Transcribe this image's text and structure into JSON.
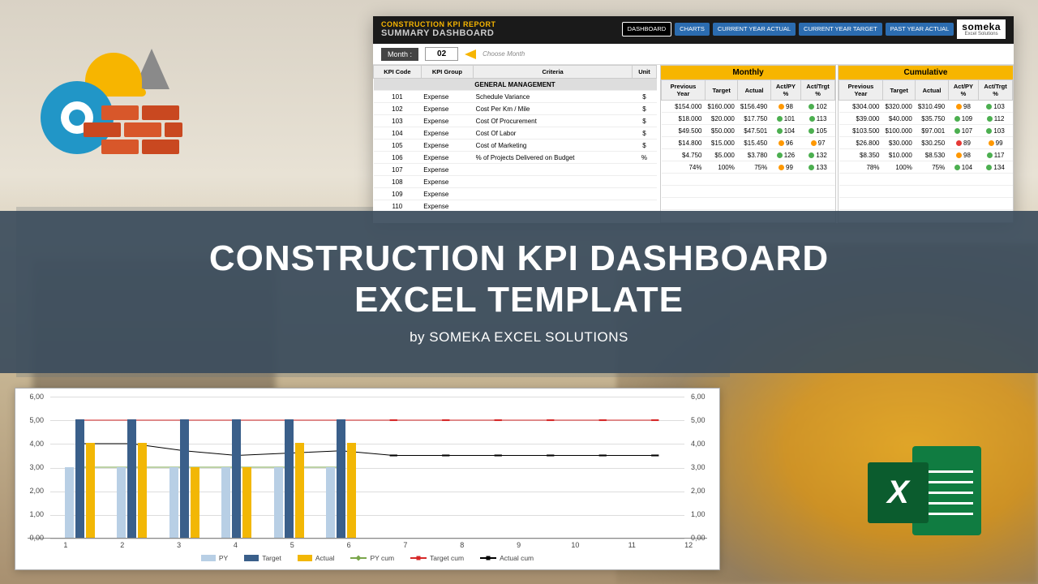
{
  "header": {
    "report": "CONSTRUCTION KPI REPORT",
    "subtitle": "SUMMARY DASHBOARD",
    "tabs": [
      "DASHBOARD",
      "CHARTS",
      "CURRENT YEAR ACTUAL",
      "CURRENT YEAR TARGET",
      "PAST YEAR ACTUAL"
    ],
    "logo_main": "someka",
    "logo_sub": "Excel Solutions"
  },
  "month": {
    "label": "Month :",
    "value": "02",
    "choose": "Choose Month"
  },
  "left_headers": [
    "KPI Code",
    "KPI Group",
    "Criteria",
    "Unit"
  ],
  "section": "GENERAL MANAGEMENT",
  "metric_titles": {
    "monthly": "Monthly",
    "cumulative": "Cumulative"
  },
  "metric_headers": [
    "Previous Year",
    "Target",
    "Actual",
    "Act/PY %",
    "Act/Trgt %"
  ],
  "rows": [
    {
      "code": "101",
      "group": "Expense",
      "crit": "Schedule Variance",
      "unit": "$",
      "m": {
        "py": "$154.000",
        "tg": "$160.000",
        "ac": "$156.490",
        "apy": "98",
        "apyc": "o",
        "atg": "102",
        "atgc": "g"
      },
      "c": {
        "py": "$304.000",
        "tg": "$320.000",
        "ac": "$310.490",
        "apy": "98",
        "apyc": "o",
        "atg": "103",
        "atgc": "g"
      }
    },
    {
      "code": "102",
      "group": "Expense",
      "crit": "Cost Per Km / Mile",
      "unit": "$",
      "m": {
        "py": "$18.000",
        "tg": "$20.000",
        "ac": "$17.750",
        "apy": "101",
        "apyc": "g",
        "atg": "113",
        "atgc": "g"
      },
      "c": {
        "py": "$39.000",
        "tg": "$40.000",
        "ac": "$35.750",
        "apy": "109",
        "apyc": "g",
        "atg": "112",
        "atgc": "g"
      }
    },
    {
      "code": "103",
      "group": "Expense",
      "crit": "Cost Of Procurement",
      "unit": "$",
      "m": {
        "py": "$49.500",
        "tg": "$50.000",
        "ac": "$47.501",
        "apy": "104",
        "apyc": "g",
        "atg": "105",
        "atgc": "g"
      },
      "c": {
        "py": "$103.500",
        "tg": "$100.000",
        "ac": "$97.001",
        "apy": "107",
        "apyc": "g",
        "atg": "103",
        "atgc": "g"
      }
    },
    {
      "code": "104",
      "group": "Expense",
      "crit": "Cost Of Labor",
      "unit": "$",
      "m": {
        "py": "$14.800",
        "tg": "$15.000",
        "ac": "$15.450",
        "apy": "96",
        "apyc": "o",
        "atg": "97",
        "atgc": "o"
      },
      "c": {
        "py": "$26.800",
        "tg": "$30.000",
        "ac": "$30.250",
        "apy": "89",
        "apyc": "r",
        "atg": "99",
        "atgc": "o"
      }
    },
    {
      "code": "105",
      "group": "Expense",
      "crit": "Cost of Marketing",
      "unit": "$",
      "m": {
        "py": "$4.750",
        "tg": "$5.000",
        "ac": "$3.780",
        "apy": "126",
        "apyc": "g",
        "atg": "132",
        "atgc": "g"
      },
      "c": {
        "py": "$8.350",
        "tg": "$10.000",
        "ac": "$8.530",
        "apy": "98",
        "apyc": "o",
        "atg": "117",
        "atgc": "g"
      }
    },
    {
      "code": "106",
      "group": "Expense",
      "crit": "% of Projects Delivered on Budget",
      "unit": "%",
      "m": {
        "py": "74%",
        "tg": "100%",
        "ac": "75%",
        "apy": "99",
        "apyc": "o",
        "atg": "133",
        "atgc": "g"
      },
      "c": {
        "py": "78%",
        "tg": "100%",
        "ac": "75%",
        "apy": "104",
        "apyc": "g",
        "atg": "134",
        "atgc": "g"
      }
    },
    {
      "code": "107",
      "group": "Expense",
      "crit": "",
      "unit": ""
    },
    {
      "code": "108",
      "group": "Expense",
      "crit": "",
      "unit": ""
    },
    {
      "code": "109",
      "group": "Expense",
      "crit": "",
      "unit": ""
    },
    {
      "code": "110",
      "group": "Expense",
      "crit": "",
      "unit": ""
    }
  ],
  "banner": {
    "line1": "CONSTRUCTION KPI DASHBOARD",
    "line2": "EXCEL TEMPLATE",
    "sub": "by SOMEKA EXCEL SOLUTIONS"
  },
  "excel_badge": "X",
  "chart_data": {
    "type": "bar",
    "categories": [
      "1",
      "2",
      "3",
      "4",
      "5",
      "6",
      "7",
      "8",
      "9",
      "10",
      "11",
      "12"
    ],
    "ylim": [
      0,
      6
    ],
    "yticks": [
      "0,00",
      "1,00",
      "2,00",
      "3,00",
      "4,00",
      "5,00",
      "6,00"
    ],
    "series_bars": [
      {
        "name": "PY",
        "color": "#b8cfe5",
        "values": [
          3.0,
          3.0,
          3.0,
          3.0,
          3.0,
          3.0,
          null,
          null,
          null,
          null,
          null,
          null
        ]
      },
      {
        "name": "Target",
        "color": "#3a5f8a",
        "values": [
          5.0,
          5.0,
          5.0,
          5.0,
          5.0,
          5.0,
          null,
          null,
          null,
          null,
          null,
          null
        ]
      },
      {
        "name": "Actual",
        "color": "#f2b705",
        "values": [
          4.0,
          4.0,
          3.0,
          3.0,
          4.0,
          4.0,
          null,
          null,
          null,
          null,
          null,
          null
        ]
      }
    ],
    "series_lines": [
      {
        "name": "PY cum",
        "color": "#7aa64b",
        "values": [
          3.0,
          3.0,
          3.0,
          3.0,
          3.0,
          3.0,
          null,
          null,
          null,
          null,
          null,
          null
        ]
      },
      {
        "name": "Target cum",
        "color": "#d62828",
        "values": [
          5.0,
          5.0,
          5.0,
          5.0,
          5.0,
          5.0,
          5.0,
          5.0,
          5.0,
          5.0,
          5.0,
          5.0
        ]
      },
      {
        "name": "Actual cum",
        "color": "#000000",
        "values": [
          4.0,
          4.0,
          3.7,
          3.5,
          3.6,
          3.7,
          3.5,
          3.5,
          3.5,
          3.5,
          3.5,
          3.5
        ]
      }
    ],
    "legend": [
      "PY",
      "Target",
      "Actual",
      "PY cum",
      "Target cum",
      "Actual cum"
    ]
  }
}
